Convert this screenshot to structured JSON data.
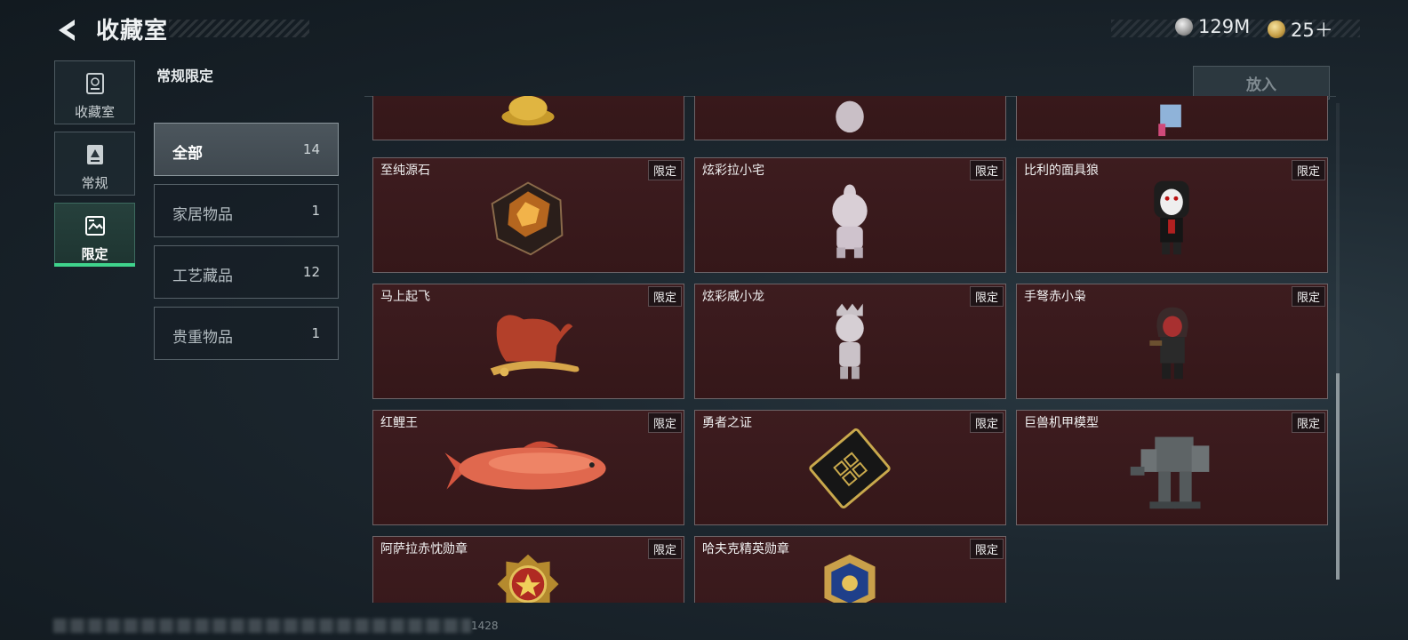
{
  "header": {
    "title": "收藏室"
  },
  "currencies": [
    {
      "icon": "silver-coin-icon",
      "value": "129M"
    },
    {
      "icon": "gold-coin-icon",
      "value": "25＋"
    }
  ],
  "sidebar": {
    "items": [
      {
        "label": "收藏室",
        "icon": "trash-bin-icon",
        "active": false
      },
      {
        "label": "常规",
        "icon": "document-icon",
        "active": false
      },
      {
        "label": "限定",
        "icon": "image-icon",
        "active": true
      }
    ]
  },
  "section_title": "常规限定",
  "categories": [
    {
      "name": "全部",
      "count": "14",
      "active": true
    },
    {
      "name": "家居物品",
      "count": "1",
      "active": false
    },
    {
      "name": "工艺藏品",
      "count": "12",
      "active": false
    },
    {
      "name": "贵重物品",
      "count": "1",
      "active": false
    }
  ],
  "place_button": "放入",
  "badge_label": "限定",
  "cards": [
    {
      "name": "至纯源石",
      "badge": "限定",
      "art": "gem-icon"
    },
    {
      "name": "炫彩拉小宅",
      "badge": "限定",
      "art": "doll-icon"
    },
    {
      "name": "比利的面具狼",
      "badge": "限定",
      "art": "puppet-icon"
    },
    {
      "name": "马上起飞",
      "badge": "限定",
      "art": "horse-icon"
    },
    {
      "name": "炫彩威小龙",
      "badge": "限定",
      "art": "figure-icon"
    },
    {
      "name": "手弩赤小枭",
      "badge": "限定",
      "art": "hooded-figure-icon"
    },
    {
      "name": "红鲤王",
      "badge": "限定",
      "art": "fish-icon"
    },
    {
      "name": "勇者之证",
      "badge": "限定",
      "art": "card-icon"
    },
    {
      "name": "巨兽机甲模型",
      "badge": "限定",
      "art": "mech-icon"
    },
    {
      "name": "阿萨拉赤忱勋章",
      "badge": "限定",
      "art": "medal-icon"
    },
    {
      "name": "哈夫克精英勋章",
      "badge": "限定",
      "art": "badge-medal-icon"
    }
  ],
  "footer": {
    "code": "1428"
  },
  "colors": {
    "accent": "#3fd38c",
    "card_bg": "#3d1c1f"
  }
}
